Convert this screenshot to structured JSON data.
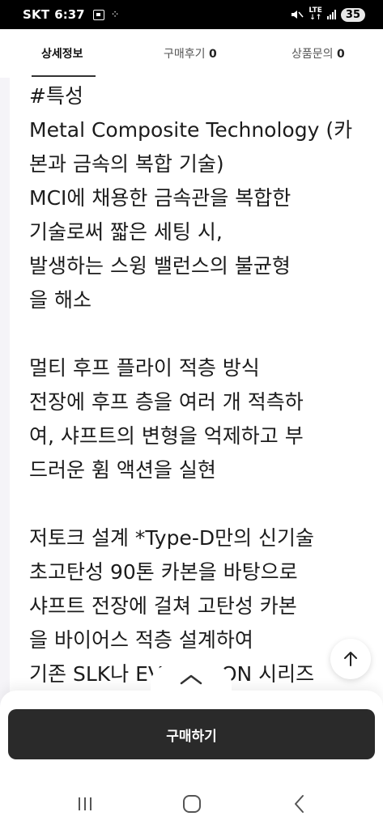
{
  "status_bar": {
    "carrier": "SKT",
    "time": "6:37",
    "network": "LTE",
    "network_sub": "↓↑",
    "battery": "35"
  },
  "tabs": [
    {
      "label": "상세정보",
      "count": ""
    },
    {
      "label": "구매후기",
      "count": "0"
    },
    {
      "label": "상품문의",
      "count": "0"
    }
  ],
  "content": {
    "lines": [
      "#특성",
      "Metal Composite Technology (카",
      "본과 금속의 복합 기술)",
      "MCI에 채용한 금속관을 복합한",
      "기술로써 짧은 세팅 시,",
      "발생하는 스윙 밸런스의 불균형",
      "을 해소",
      "",
      "멀티 후프 플라이 적층 방식",
      "전장에 후프 층을 여러 개 적측하",
      "여, 샤프트의 변형을 억제하고 부",
      "드러운 휨 액션을 실현",
      "",
      "저토크 설계 *Type-D만의 신기술",
      "초고탄성 90톤 카본을 바탕으로",
      "샤프트 전장에 걸쳐 고탄성 카본",
      "을 바이어스 적층 설계하여",
      "기존 SLK나 EVOLUTION 시리즈"
    ]
  },
  "buy_button": {
    "label": "구매하기"
  }
}
